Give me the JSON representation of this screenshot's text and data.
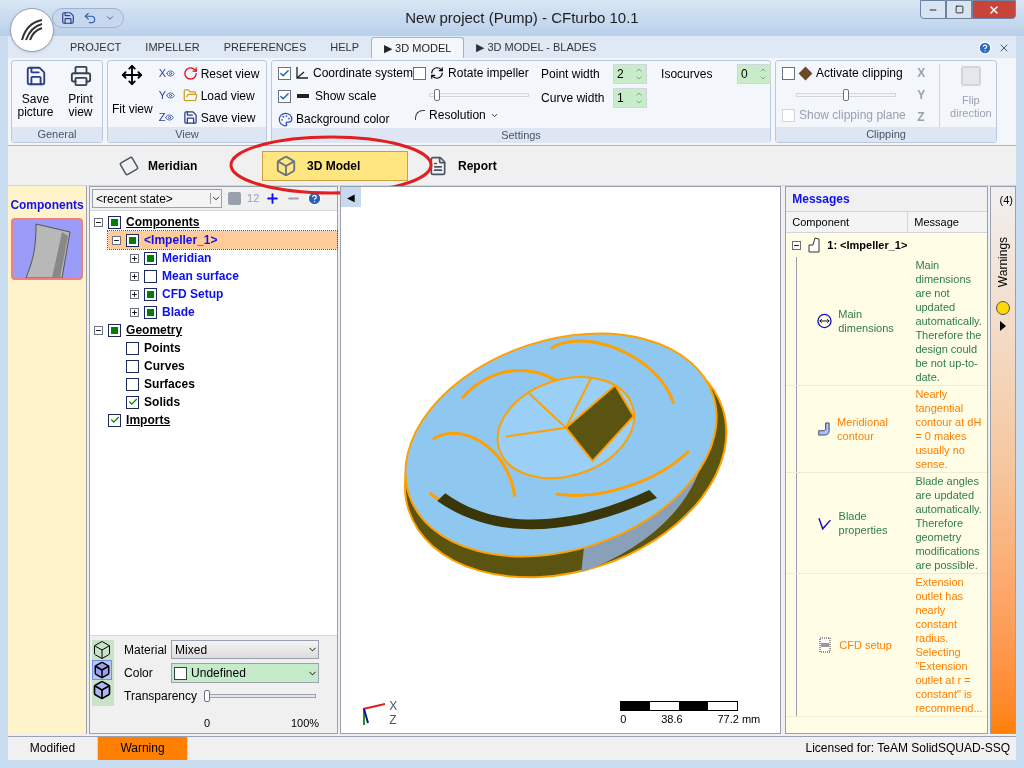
{
  "window": {
    "title": "New project (Pump) - CFturbo 10.1"
  },
  "ribbon_tabs": [
    {
      "label": "PROJECT",
      "selected": false
    },
    {
      "label": "IMPELLER",
      "selected": false
    },
    {
      "label": "PREFERENCES",
      "selected": false
    },
    {
      "label": "HELP",
      "selected": false
    },
    {
      "label": "▶ 3D MODEL",
      "selected": true
    },
    {
      "label": "▶ 3D MODEL - BLADES",
      "selected": false
    }
  ],
  "general": {
    "label": "General",
    "save": "Save picture",
    "print": "Print view"
  },
  "view": {
    "label": "View",
    "fit": "Fit view",
    "axes": [
      "X",
      "Y",
      "Z"
    ],
    "buttons": [
      "Reset view",
      "Load view",
      "Save view"
    ]
  },
  "settings": {
    "label": "Settings",
    "coordinate_system": {
      "label": "Coordinate system",
      "checked": true
    },
    "show_scale": {
      "label": "Show scale",
      "checked": true
    },
    "background_color": "Background color",
    "rotate_impeller": {
      "label": "Rotate impeller",
      "checked": false
    },
    "rotate_speed": {
      "level": 0.05,
      "disabled": true
    },
    "resolution": "Resolution",
    "point_width": {
      "label": "Point width",
      "value": "2"
    },
    "curve_width": {
      "label": "Curve width",
      "value": "1"
    },
    "isocurves": {
      "label": "Isocurves",
      "value": "0"
    }
  },
  "clipping": {
    "label": "Clipping",
    "activate": {
      "label": "Activate clipping",
      "checked": false
    },
    "position": {
      "level": 0.5,
      "disabled": true
    },
    "show_plane": {
      "label": "Show clipping plane",
      "checked": false,
      "disabled": true
    },
    "axes": [
      "X",
      "Y",
      "Z"
    ],
    "flip": {
      "label": "Flip direction",
      "disabled": true
    }
  },
  "view_tabs": [
    {
      "label": "Meridian",
      "selected": false,
      "kind": "meridian"
    },
    {
      "label": "3D Model",
      "selected": true,
      "kind": "model"
    },
    {
      "label": "Report",
      "selected": false,
      "kind": "report"
    }
  ],
  "side_strip": {
    "title": "Components"
  },
  "tree_toolbar": {
    "state": "<recent state>",
    "numbering": "12"
  },
  "tree": [
    {
      "label": "Components",
      "kind": "square",
      "checked": true,
      "expanded": true,
      "selected": false,
      "children": [
        {
          "label": "<Impeller_1>",
          "kind": "square",
          "checked": true,
          "expanded": true,
          "selected": true,
          "children": [
            {
              "label": "Meridian",
              "kind": "square",
              "checked": true,
              "expanded": false,
              "selected": false
            },
            {
              "label": "Mean surface",
              "kind": "square",
              "checked": false,
              "expanded": false,
              "selected": false
            },
            {
              "label": "CFD Setup",
              "kind": "square",
              "checked": true,
              "expanded": false,
              "selected": false
            },
            {
              "label": "Blade",
              "kind": "square",
              "checked": true,
              "expanded": false,
              "selected": false
            }
          ]
        }
      ]
    },
    {
      "label": "Geometry",
      "kind": "square",
      "checked": true,
      "expanded": true,
      "selected": false,
      "children": [
        {
          "label": "Points",
          "kind": "tick",
          "checked": false,
          "selected": false
        },
        {
          "label": "Curves",
          "kind": "tick",
          "checked": false,
          "selected": false
        },
        {
          "label": "Surfaces",
          "kind": "tick",
          "checked": false,
          "selected": false
        },
        {
          "label": "Solids",
          "kind": "tick",
          "checked": true,
          "selected": false
        }
      ]
    },
    {
      "label": "Imports",
      "kind": "tick",
      "checked": true,
      "selected": false
    }
  ],
  "properties": {
    "material": {
      "label": "Material",
      "value": "Mixed"
    },
    "color": {
      "label": "Color",
      "value": "Undefined"
    },
    "transparency": {
      "label": "Transparency",
      "level": 0,
      "min": "0",
      "max": "100%"
    }
  },
  "viewport": {
    "collapse": "◀",
    "axis_x": "X",
    "axis_z": "Z",
    "scale": [
      "0",
      "38.6",
      "77.2 mm"
    ]
  },
  "messages": {
    "title": "Messages",
    "count": "(4)",
    "columns": [
      "Component",
      "Message"
    ],
    "group": {
      "label": "1: <Impeller_1>",
      "expanded": true
    },
    "rows": [
      {
        "component": "Main dimensions",
        "message": "Main dimensions are not updated automatically. Therefore the design could be not up-to-date.",
        "kind": "info"
      },
      {
        "component": "Meridional contour",
        "message": "Nearly tangential contour at dH = 0 makes usually no sense.",
        "kind": "warning"
      },
      {
        "component": "Blade properties",
        "message": "Blade angles are updated automatically. Therefore geometry modifications are possible.",
        "kind": "info"
      },
      {
        "component": "CFD setup",
        "message": "Extension outlet has nearly constant radius. Selecting \"Extension outlet at r = constant\" is recommend...",
        "kind": "warning"
      }
    ]
  },
  "warnings_tab": {
    "label": "Warnings"
  },
  "status_bar": [
    {
      "text": "Modified",
      "kind": "plain"
    },
    {
      "text": "Warning",
      "kind": "warning"
    },
    {
      "text": "Licensed for: TeAM SolidSQUAD-SSQ",
      "kind": "license"
    }
  ]
}
